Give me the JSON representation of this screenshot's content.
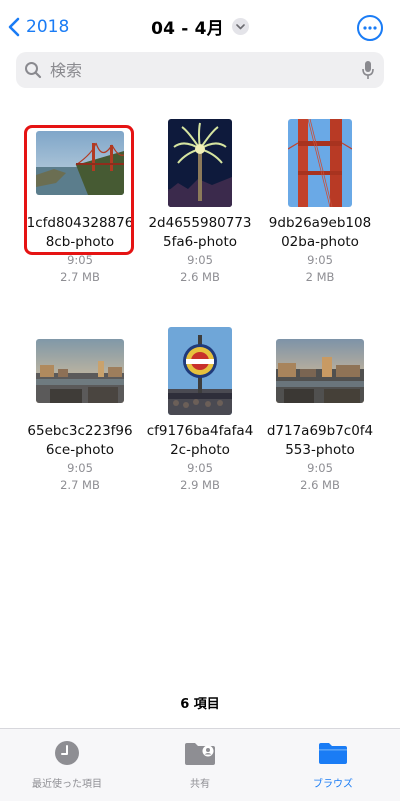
{
  "nav": {
    "back_label": "2018",
    "title": "04 - 4月"
  },
  "search": {
    "placeholder": "検索"
  },
  "files": [
    {
      "name": "1cfd8043288768cb-photo",
      "time": "9:05",
      "size": "2.7 MB",
      "selected": true
    },
    {
      "name": "2d46559807735fa6-photo",
      "time": "9:05",
      "size": "2.6 MB"
    },
    {
      "name": "9db26a9eb10802ba-photo",
      "time": "9:05",
      "size": "2 MB"
    },
    {
      "name": "65ebc3c223f966ce-photo",
      "time": "9:05",
      "size": "2.7 MB"
    },
    {
      "name": "cf9176ba4fafa42c-photo",
      "time": "9:05",
      "size": "2.9 MB"
    },
    {
      "name": "d717a69b7c0f4553-photo",
      "time": "9:05",
      "size": "2.6 MB"
    }
  ],
  "item_count": "6 項目",
  "tabs": [
    {
      "label": "最近使った項目",
      "icon": "clock-icon"
    },
    {
      "label": "共有",
      "icon": "shared-folder-icon"
    },
    {
      "label": "ブラウズ",
      "icon": "folder-icon",
      "active": true
    }
  ],
  "colors": {
    "accent": "#1a7cf5",
    "highlight": "#e51313"
  }
}
